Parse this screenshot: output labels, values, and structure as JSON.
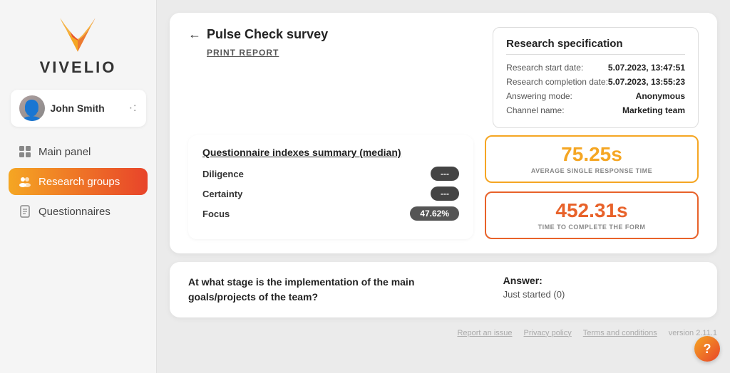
{
  "sidebar": {
    "logo_text": "VIVELIO",
    "user": {
      "name": "John Smith",
      "menu_dots": "·:"
    },
    "nav": [
      {
        "id": "main-panel",
        "label": "Main panel",
        "icon": "grid",
        "active": false
      },
      {
        "id": "research-groups",
        "label": "Research groups",
        "icon": "people",
        "active": true
      },
      {
        "id": "questionnaires",
        "label": "Questionnaires",
        "icon": "doc",
        "active": false
      }
    ]
  },
  "main": {
    "back_arrow": "←",
    "survey_title": "Pulse Check survey",
    "print_report": "PRINT REPORT",
    "research_spec": {
      "title": "Research specification",
      "rows": [
        {
          "label": "Research start date:",
          "value": "5.07.2023, 13:47:51"
        },
        {
          "label": "Research completion date:",
          "value": "5.07.2023, 13:55:23"
        },
        {
          "label": "Answering mode:",
          "value": "Anonymous"
        },
        {
          "label": "Channel name:",
          "value": "Marketing team"
        }
      ]
    },
    "questionnaire_indexes": {
      "title": "Questionnaire indexes summary (median)",
      "rows": [
        {
          "label": "Diligence",
          "value": "---"
        },
        {
          "label": "Certainty",
          "value": "---"
        },
        {
          "label": "Focus",
          "value": "47.62%"
        }
      ]
    },
    "stats": [
      {
        "id": "avg-response",
        "value": "75.25s",
        "label": "AVERAGE SINGLE RESPONSE TIME",
        "color": "orange1"
      },
      {
        "id": "complete-form",
        "value": "452.31s",
        "label": "TIME TO COMPLETE THE FORM",
        "color": "orange2"
      }
    ],
    "bottom_card": {
      "question": "At what stage is the implementation of the main goals/projects of the team?",
      "answer_label": "Answer:",
      "answer_value": "Just started (0)"
    },
    "footer": {
      "report_issue": "Report an issue",
      "privacy_policy": "Privacy policy",
      "terms": "Terms and conditions",
      "version": "version 2.11.1"
    },
    "help_btn": "?"
  }
}
